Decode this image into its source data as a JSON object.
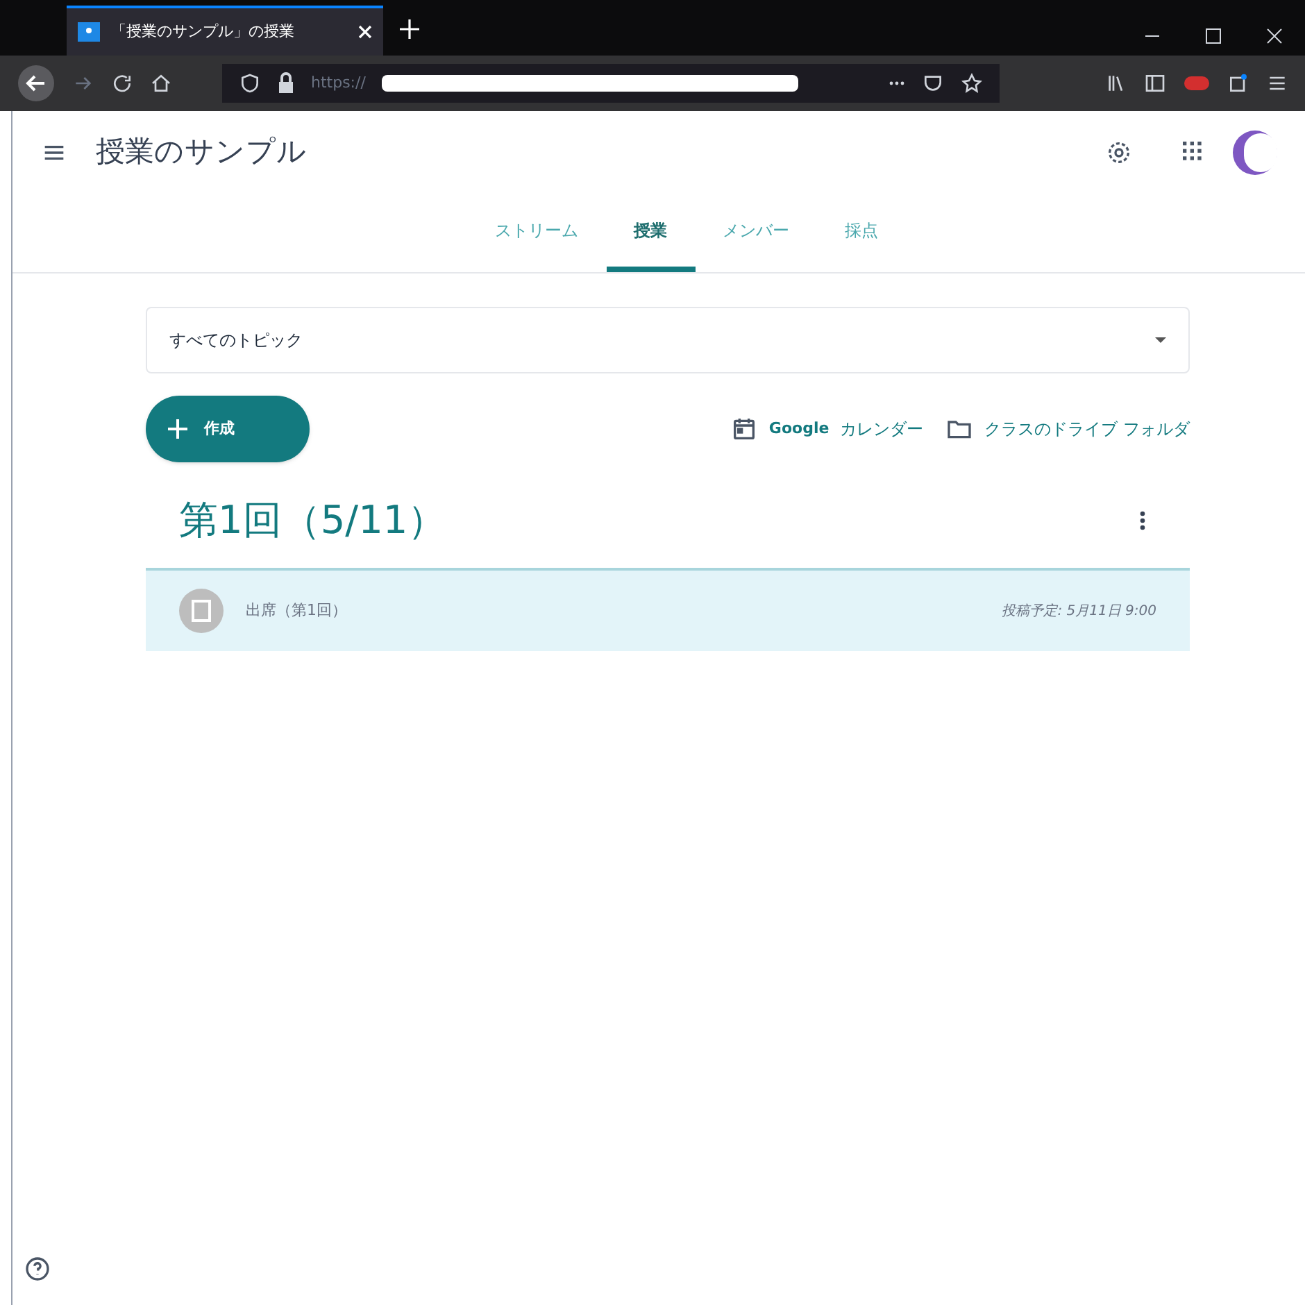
{
  "browser": {
    "tab_title": "「授業のサンプル」の授業",
    "url": "https://"
  },
  "header": {
    "class_name": "授業のサンプル"
  },
  "tabs": [
    {
      "label": "ストリーム",
      "selected": false
    },
    {
      "label": "授業",
      "selected": true
    },
    {
      "label": "メンバー",
      "selected": false
    },
    {
      "label": "採点",
      "selected": false
    }
  ],
  "topic_filter": {
    "value": "すべてのトピック"
  },
  "create_button": "作成",
  "links": [
    {
      "kind": "calendar",
      "prefix": "Google",
      "label": "カレンダー"
    },
    {
      "kind": "folder",
      "label": "クラスのドライブ フォルダ"
    }
  ],
  "topic": {
    "title": "第1回（5/11）",
    "items": [
      {
        "title": "出席（第1回）",
        "scheduled": "投稿予定: 5月11日 9:00",
        "selected": true
      }
    ]
  }
}
